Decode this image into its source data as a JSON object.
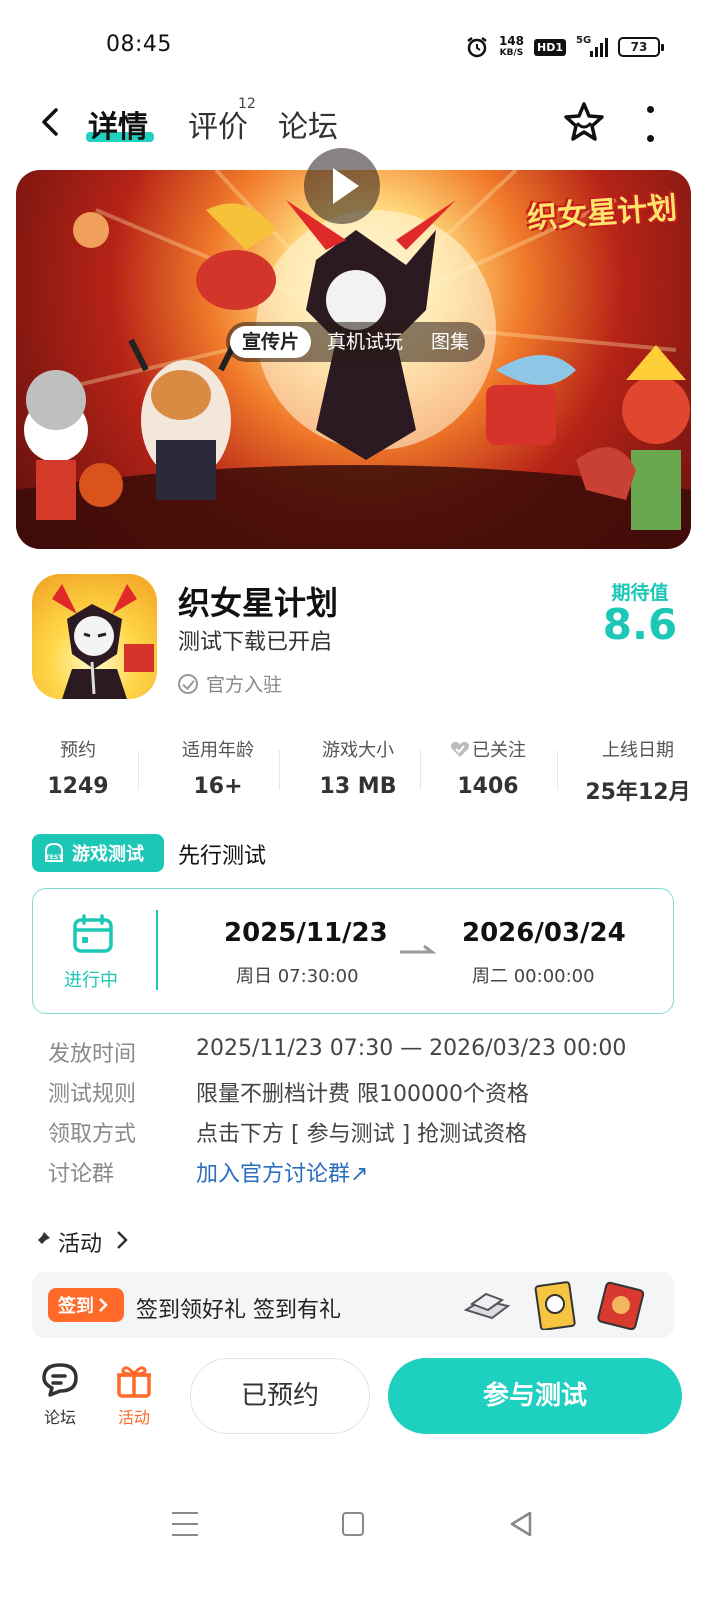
{
  "status_bar": {
    "time": "08:45",
    "net_speed_value": "148",
    "net_speed_unit": "KB/S",
    "hd_label": "HD1",
    "network_label": "5G",
    "battery": "73",
    "icons": [
      "alarm-icon",
      "signal-icon",
      "battery-icon"
    ]
  },
  "header": {
    "tabs": [
      {
        "label": "详情",
        "active": true
      },
      {
        "label": "评价",
        "badge": "12"
      },
      {
        "label": "论坛"
      }
    ],
    "icons": [
      "back-arrow-icon",
      "star-icon",
      "more-vertical-icon"
    ],
    "accent_color": "#21d0c0"
  },
  "banner": {
    "overlay_title": "织女星计划",
    "media_tabs": [
      "宣传片",
      "真机试玩",
      "图集"
    ],
    "active_media_tab": "宣传片"
  },
  "game": {
    "name": "织女星计划",
    "subtitle": "测试下载已开启",
    "official_label": "官方入驻",
    "expectation_label": "期待值",
    "expectation_value": "8.6"
  },
  "stats": [
    {
      "label": "预约",
      "value": "1249"
    },
    {
      "label": "适用年龄",
      "value": "16+"
    },
    {
      "label": "游戏大小",
      "value": "13 MB"
    },
    {
      "label": "已关注",
      "value": "1406"
    },
    {
      "label": "上线日期",
      "value": "25年12月"
    }
  ],
  "test": {
    "badge_label": "游戏测试",
    "title": "先行测试",
    "status": "进行中",
    "start_date": "2025/11/23",
    "start_time": "周日  07:30:00",
    "end_date": "2026/03/24",
    "end_time": "周二  00:00:00",
    "rows": [
      {
        "key": "发放时间",
        "value": "2025/11/23 07:30 — 2026/03/23 00:00"
      },
      {
        "key": "测试规则",
        "value": "限量不删档计费 限100000个资格"
      },
      {
        "key": "领取方式",
        "value": "点击下方 [ 参与测试 ] 抢测试资格"
      },
      {
        "key": "讨论群",
        "value": "加入官方讨论群↗",
        "link": true
      }
    ]
  },
  "activity": {
    "title": "活动",
    "tag": "签到",
    "text": "签到领好礼 签到有礼",
    "tag_color": "#ff6a2b"
  },
  "bottom_bar": {
    "forum_label": "论坛",
    "activity_label": "活动",
    "reserved_label": "已预约",
    "join_label": "参与测试",
    "join_color": "#1ed0c0"
  }
}
